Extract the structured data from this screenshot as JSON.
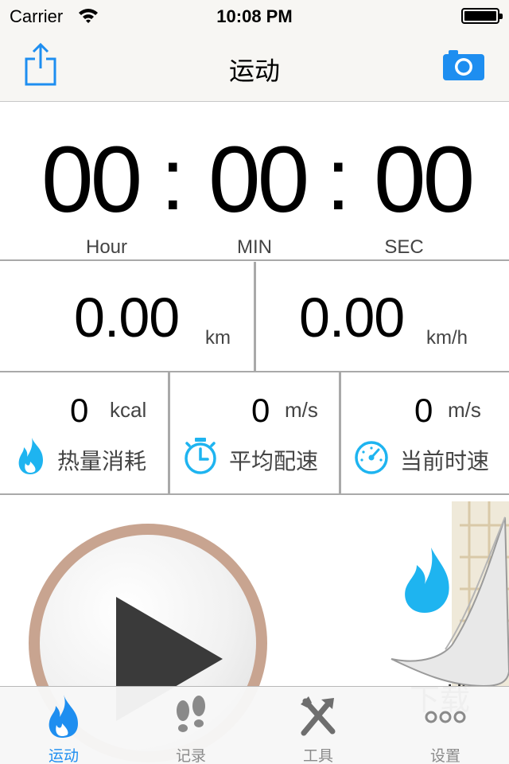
{
  "status_bar": {
    "carrier": "Carrier",
    "time": "10:08 PM"
  },
  "nav": {
    "title": "运动",
    "share_icon": "share-icon",
    "camera_icon": "camera-icon"
  },
  "timer": {
    "hours": "00",
    "minutes": "00",
    "seconds": "00",
    "separator": ":",
    "labels": {
      "hour": "Hour",
      "min": "MIN",
      "sec": "SEC"
    }
  },
  "distance": {
    "value": "0.00",
    "unit": "km"
  },
  "speed": {
    "value": "0.00",
    "unit": "km/h"
  },
  "stats": [
    {
      "value": "0",
      "unit": "kcal",
      "label": "热量消耗",
      "icon": "flame-icon"
    },
    {
      "value": "0",
      "unit": "m/s",
      "label": "平均配速",
      "icon": "stopwatch-icon"
    },
    {
      "value": "0",
      "unit": "m/s",
      "label": "当前时速",
      "icon": "speedometer-icon"
    }
  ],
  "map_caption": "下载",
  "tabs": [
    {
      "label": "运动",
      "icon": "flame-icon",
      "active": true
    },
    {
      "label": "记录",
      "icon": "footprints-icon",
      "active": false
    },
    {
      "label": "工具",
      "icon": "tools-icon",
      "active": false
    },
    {
      "label": "设置",
      "icon": "more-icon",
      "active": false
    }
  ],
  "colors": {
    "accent": "#1e8ef0",
    "divider": "#a9a9a9",
    "play_ring": "#c8a490"
  }
}
